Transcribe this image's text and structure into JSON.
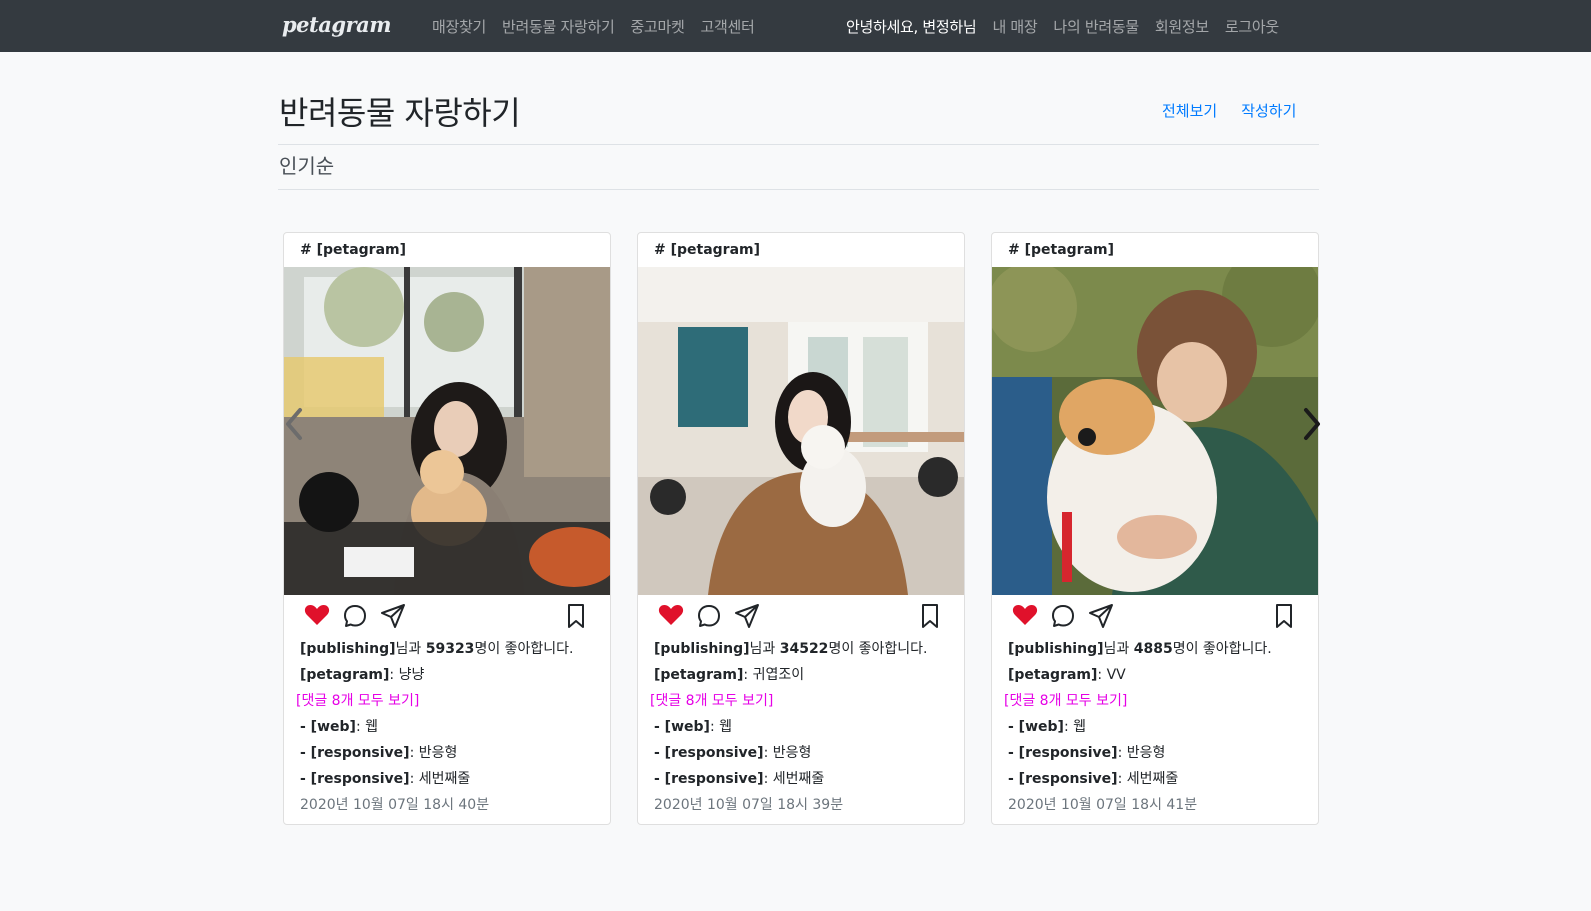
{
  "navbar": {
    "brand": "petagram",
    "left_links": [
      "매장찾기",
      "반려동물 자랑하기",
      "중고마켓",
      "고객센터"
    ],
    "greeting": "안녕하세요, 변정하님",
    "right_links": [
      "내 매장",
      "나의 반려동물",
      "회원정보",
      "로그아웃"
    ]
  },
  "page": {
    "title": "반려동물 자랑하기",
    "view_all": "전체보기",
    "write": "작성하기",
    "sort_label": "인기순"
  },
  "colors": {
    "navbar_bg": "#343a40",
    "link_blue": "#007bff",
    "heart_red": "#e0112b",
    "comment_link": "#e600e6"
  },
  "icons": [
    "heart-icon",
    "comment-icon",
    "send-icon",
    "bookmark-icon",
    "chevron-left-icon",
    "chevron-right-icon"
  ],
  "cards": [
    {
      "header": "# [petagram]",
      "likes_user": "[publishing]",
      "likes_mid": "님과 ",
      "likes_count": "59323",
      "likes_suffix": "명이 좋아합니다.",
      "author": "[petagram]",
      "caption": ": 냥냥",
      "comments_link": "[댓글 8개 모두 보기]",
      "comments": [
        {
          "user": "- [web]",
          "text": ": 웹"
        },
        {
          "user": "- [responsive]",
          "text": ": 반응형"
        },
        {
          "user": "- [responsive]",
          "text": ": 세번째줄"
        }
      ],
      "timestamp": "2020년 10월 07일 18시 40분"
    },
    {
      "header": "# [petagram]",
      "likes_user": "[publishing]",
      "likes_mid": "님과 ",
      "likes_count": "34522",
      "likes_suffix": "명이 좋아합니다.",
      "author": "[petagram]",
      "caption": ": 귀엽조이",
      "comments_link": "[댓글 8개 모두 보기]",
      "comments": [
        {
          "user": "- [web]",
          "text": ": 웹"
        },
        {
          "user": "- [responsive]",
          "text": ": 반응형"
        },
        {
          "user": "- [responsive]",
          "text": ": 세번째줄"
        }
      ],
      "timestamp": "2020년 10월 07일 18시 39분"
    },
    {
      "header": "# [petagram]",
      "likes_user": "[publishing]",
      "likes_mid": "님과 ",
      "likes_count": "4885",
      "likes_suffix": "명이 좋아합니다.",
      "author": "[petagram]",
      "caption": ": VV",
      "comments_link": "[댓글 8개 모두 보기]",
      "comments": [
        {
          "user": "- [web]",
          "text": ": 웹"
        },
        {
          "user": "- [responsive]",
          "text": ": 반응형"
        },
        {
          "user": "- [responsive]",
          "text": ": 세번째줄"
        }
      ],
      "timestamp": "2020년 10월 07일 18시 41분"
    }
  ]
}
